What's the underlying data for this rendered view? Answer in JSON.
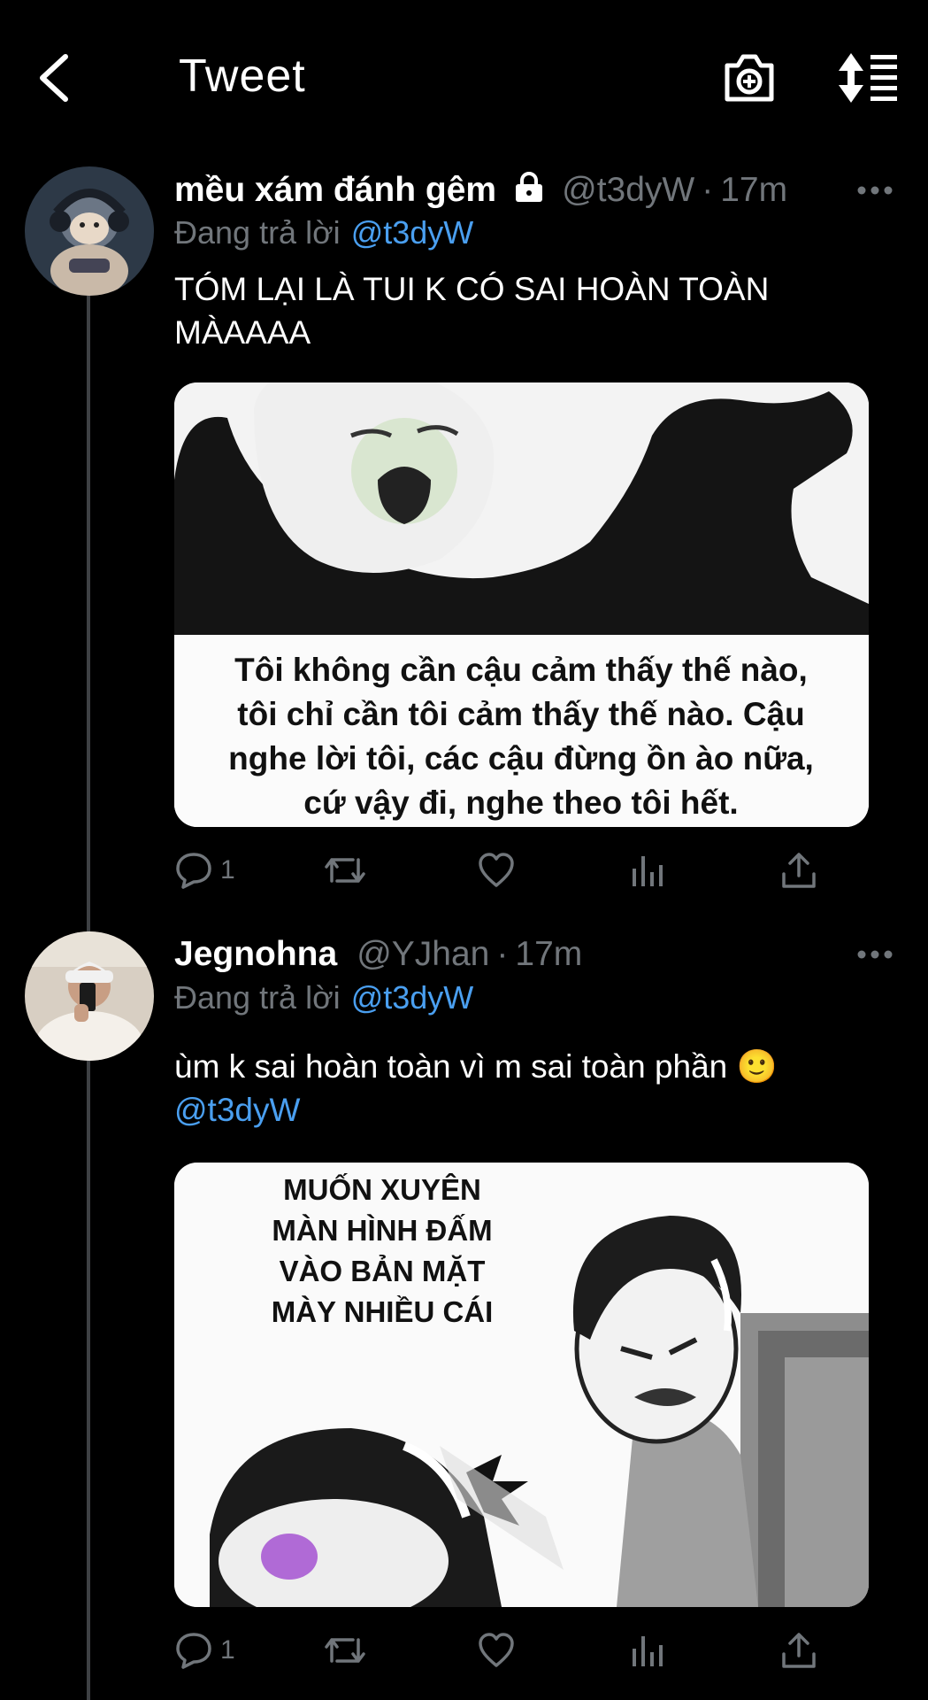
{
  "header": {
    "back_icon": "chevron-left-icon",
    "title": "Tweet",
    "camera_icon": "camera-plus-icon",
    "sort_icon": "sort-list-icon"
  },
  "tweets": [
    {
      "display_name": "mều xám đánh gêm",
      "locked": true,
      "handle": "@t3dyW",
      "dot": "·",
      "time": "17m",
      "reply_label": "Đang trả lời",
      "reply_to": "@t3dyW",
      "text": "TÓM LẠI LÀ TUI K CÓ SAI HOÀN TOÀN MÀAAAA",
      "media_caption": [
        "Tôi không cần cậu cảm thấy thế nào,",
        "tôi chỉ cần tôi cảm thấy thế nào. Cậu",
        "nghe lời tôi, các cậu đừng ồn ào nữa,",
        "cứ vậy đi, nghe theo tôi hết."
      ],
      "reply_count": "1"
    },
    {
      "display_name": "Jegnohna",
      "locked": false,
      "handle": "@YJhan",
      "dot": "·",
      "time": "17m",
      "reply_label": "Đang trả lời",
      "reply_to": "@t3dyW",
      "text": "ùm k sai hoàn toàn vì m sai toàn phần 🙂",
      "text_mention": "@t3dyW",
      "media_caption": [
        "MUỐN XUYÊN",
        "MÀN HÌNH ĐẤM",
        "VÀO BẢN MẶT",
        "MÀY NHIỀU CÁI"
      ],
      "reply_count": "1"
    }
  ],
  "colors": {
    "background": "#000000",
    "link": "#4a9ff0",
    "secondary_text": "#71767b"
  }
}
